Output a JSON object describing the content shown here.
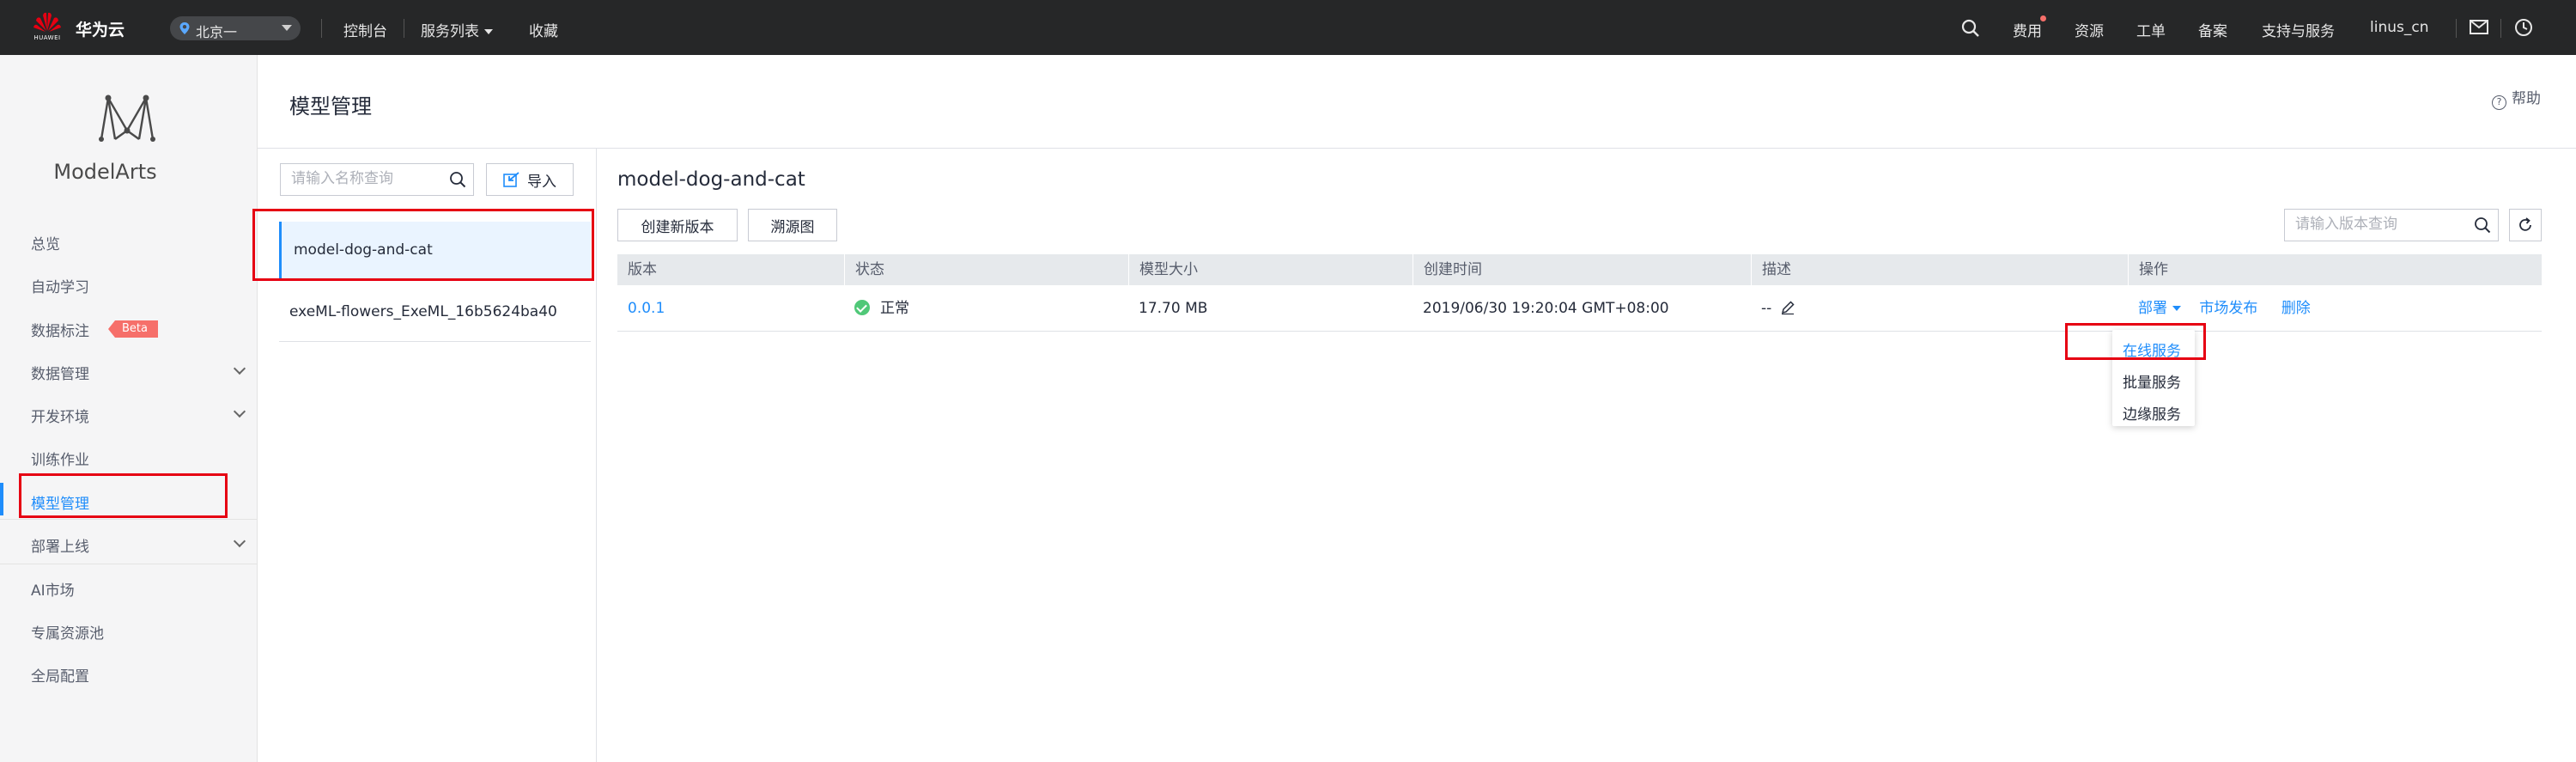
{
  "topbar": {
    "logo_text": "HUAWEI",
    "brand": "华为云",
    "region": "北京一",
    "nav": [
      "控制台",
      "服务列表",
      "收藏"
    ],
    "right_nav": [
      "费用",
      "资源",
      "工单",
      "备案",
      "支持与服务"
    ],
    "username": "linus_cn",
    "icons": [
      "search-icon",
      "mail-icon",
      "clock-icon"
    ],
    "colors": {
      "background": "#262728",
      "notice_dot": "#f66f6a"
    }
  },
  "sidebar": {
    "brand": "ModelArts",
    "items": [
      {
        "label": "总览",
        "expandable": false,
        "active": false
      },
      {
        "label": "自动学习",
        "expandable": false,
        "active": false
      },
      {
        "label": "数据标注",
        "expandable": false,
        "active": false,
        "badge": "Beta"
      },
      {
        "label": "数据管理",
        "expandable": true,
        "active": false
      },
      {
        "label": "开发环境",
        "expandable": true,
        "active": false
      },
      {
        "label": "训练作业",
        "expandable": false,
        "active": false
      },
      {
        "label": "模型管理",
        "expandable": false,
        "active": true
      },
      {
        "label": "部署上线",
        "expandable": true,
        "active": false
      },
      {
        "label": "AI市场",
        "expandable": false,
        "active": false
      },
      {
        "label": "专属资源池",
        "expandable": false,
        "active": false
      },
      {
        "label": "全局配置",
        "expandable": false,
        "active": false
      }
    ]
  },
  "page": {
    "title": "模型管理",
    "help": "帮助"
  },
  "model_list": {
    "search_placeholder": "请输入名称查询",
    "import_label": "导入",
    "items": [
      {
        "name": "model-dog-and-cat",
        "selected": true
      },
      {
        "name": "exeML-flowers_ExeML_16b5624ba40",
        "selected": false
      }
    ]
  },
  "detail": {
    "title": "model-dog-and-cat",
    "buttons": {
      "create_version": "创建新版本",
      "lineage": "溯源图"
    },
    "version_search_placeholder": "请输入版本查询",
    "columns": [
      "版本",
      "状态",
      "模型大小",
      "创建时间",
      "描述",
      "操作"
    ],
    "rows": [
      {
        "version": "0.0.1",
        "status": "正常",
        "size": "17.70 MB",
        "created": "2019/06/30 19:20:04 GMT+08:00",
        "description": "--",
        "actions": {
          "deploy": "部署",
          "publish": "市场发布",
          "delete": "删除"
        }
      }
    ],
    "deploy_menu": [
      "在线服务",
      "批量服务",
      "边缘服务"
    ],
    "colors": {
      "link": "#1f8dfb",
      "status_ok": "#50c878",
      "highlight": "#e60012"
    }
  }
}
